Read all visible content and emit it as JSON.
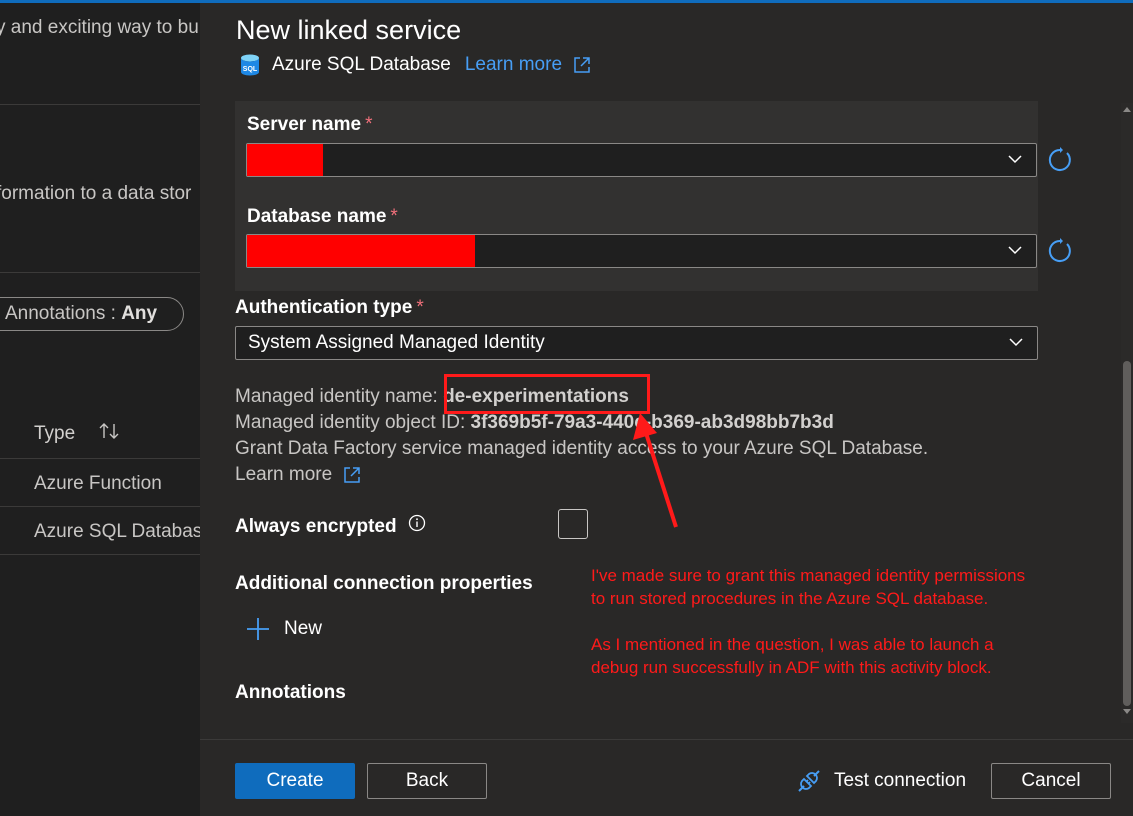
{
  "background": {
    "text_top": "y and exciting way to bu",
    "text_info": "formation to a data stor",
    "annotations_filter_label": "Annotations : ",
    "annotations_filter_value": "Any",
    "type_header": "Type",
    "rows": [
      "Azure Function",
      "Azure SQL Databas"
    ]
  },
  "panel": {
    "title": "New linked service",
    "subtitle": "Azure SQL Database",
    "learn_more": "Learn more",
    "server_name_label": "Server name",
    "database_name_label": "Database name",
    "required_mark": "*",
    "auth_type_label": "Authentication type",
    "auth_type_value": "System Assigned Managed Identity",
    "mi_name_label": "Managed identity name: ",
    "mi_name_value": "de-experimentations",
    "mi_object_label": "Managed identity object ID: ",
    "mi_object_value": "3f369b5f-79a3-440c-b369-ab3d98bb7b3d",
    "grant_text": "Grant Data Factory service managed identity access to your Azure SQL Database.",
    "learn_more_2": "Learn more",
    "always_encrypted_label": "Always encrypted",
    "additional_props_label": "Additional connection properties",
    "new_label": "New",
    "annotations_label": "Annotations"
  },
  "annotation": {
    "line1": "I've made sure to grant this managed identity permissions",
    "line2": "to run stored procedures in the Azure SQL database.",
    "line3": "As I mentioned in the question, I was able to launch a",
    "line4": "debug run successfully in ADF with this activity block."
  },
  "footer": {
    "create": "Create",
    "back": "Back",
    "test_connection": "Test connection",
    "cancel": "Cancel"
  },
  "icons": {
    "sql_icon": "sql-database-icon",
    "external_link": "external-link-icon",
    "refresh": "refresh-icon",
    "chevron": "chevron-down-icon",
    "sort": "sort-icon",
    "info": "info-icon",
    "plus": "plus-icon",
    "plug": "plug-icon"
  },
  "colors": {
    "accent": "#0f6cbd",
    "link": "#479ef5",
    "required": "#f1707b",
    "annotation_red": "#ff1a1a",
    "redaction": "#ff0000"
  }
}
